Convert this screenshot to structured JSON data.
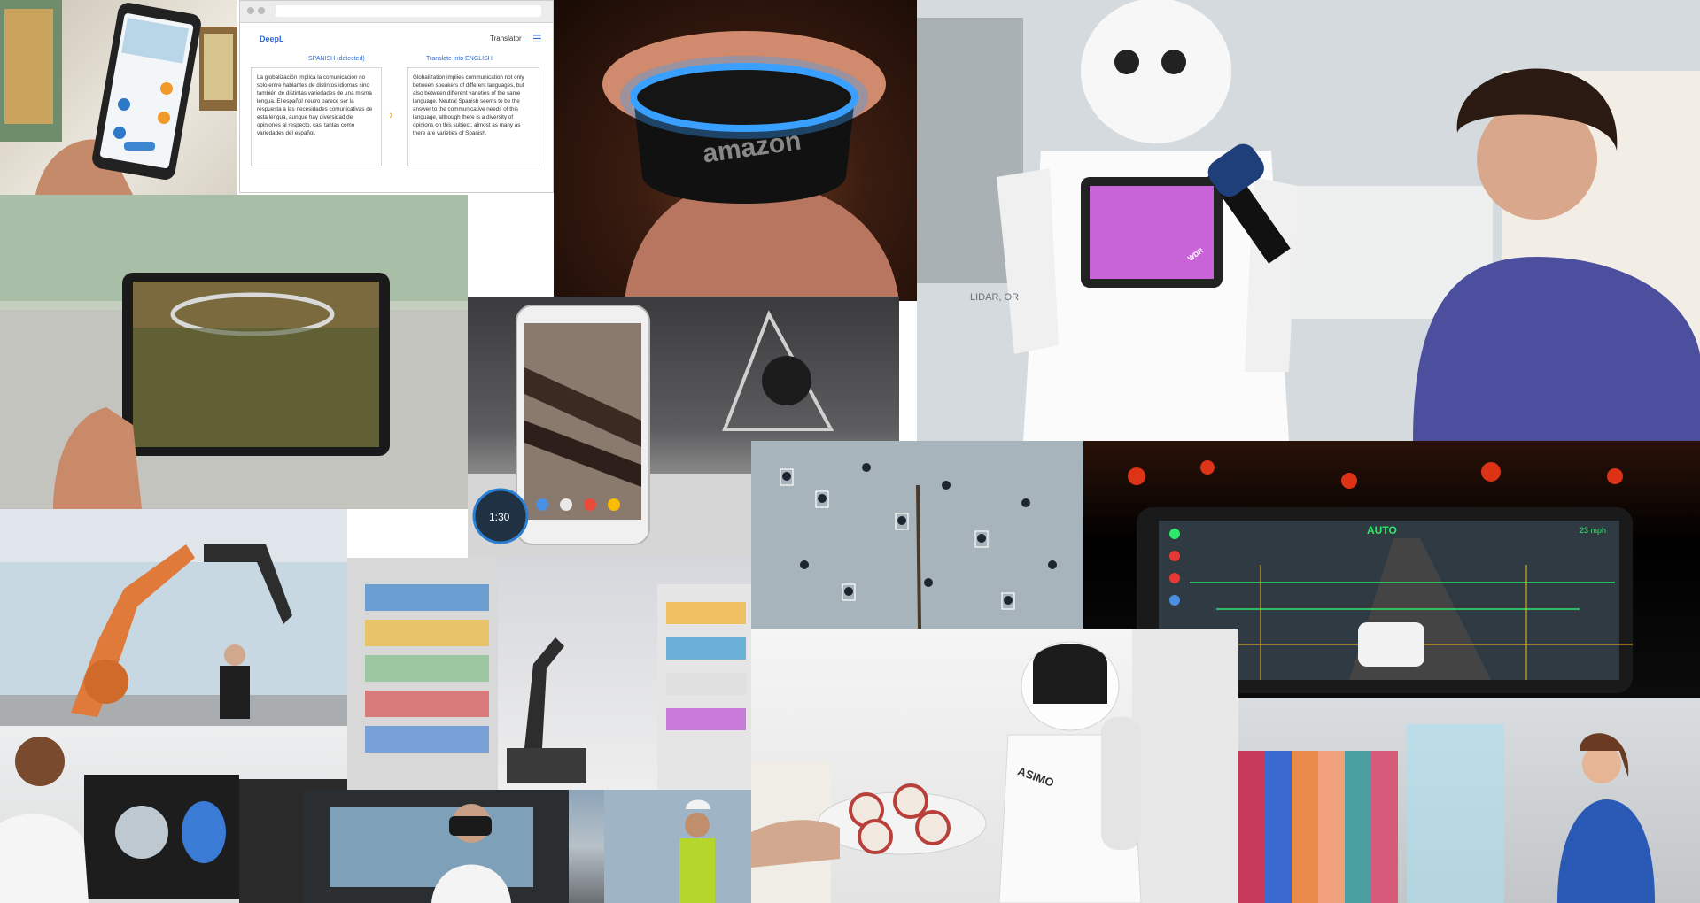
{
  "deepl": {
    "logo": "DeepL",
    "nav": "Translator",
    "source_lang": "SPANISH (detected)",
    "target_lang": "Translate into ENGLISH",
    "source_text": "La globalización implica la comunicación no solo entre hablantes de distintos idiomas sino también de distintas variedades de una misma lengua. El español neutro parece ser la respuesta a las necesidades comunicativas de esta lengua, aunque hay diversidad de opiniones al respecto, casi tantas como variedades del español.",
    "target_text": "Globalization implies communication not only between speakers of different languages, but also between different varieties of the same language. Neutral Spanish seems to be the answer to the communicative needs of this language, although there is a diversity of opinions on this subject, almost as many as there are varieties of Spanish."
  },
  "amazon": {
    "logo": "amazon"
  },
  "pepper": {
    "mic_flag": "WDR",
    "background_text": "LIDAR, OR"
  },
  "pixel": {
    "timer": "1:30"
  },
  "hud": {
    "mode": "AUTO",
    "speed": "23 mph"
  },
  "asimo": {
    "name": "ASIMO"
  },
  "colors": {
    "echo_ring": "#3aa0ff",
    "pepper_tablet": "#c864d8",
    "hud_green": "#2ee86a"
  }
}
